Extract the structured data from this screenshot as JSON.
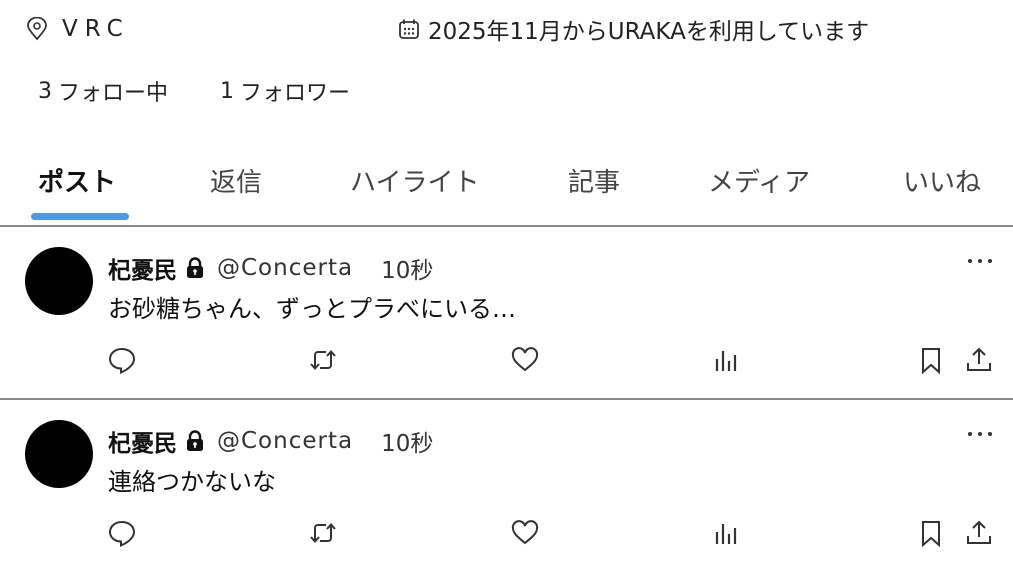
{
  "profile": {
    "location": "VRC",
    "joined": "2025年11月からURAKAを利用しています",
    "following_count": "3",
    "following_label": "フォロー中",
    "followers_count": "1",
    "followers_label": "フォロワー"
  },
  "tabs": [
    {
      "label": "ポスト",
      "active": true
    },
    {
      "label": "返信"
    },
    {
      "label": "ハイライト"
    },
    {
      "label": "記事"
    },
    {
      "label": "メディア"
    },
    {
      "label": "いいね"
    }
  ],
  "posts": [
    {
      "name": "杞憂民",
      "handle": "@Concerta",
      "time": "10秒",
      "text": "お砂糖ちゃん、ずっとプラべにいる…"
    },
    {
      "name": "杞憂民",
      "handle": "@Concerta",
      "time": "10秒",
      "text": "連絡つかないな"
    }
  ],
  "colors": {
    "accent": "#4a9ae8",
    "divider": "#8a8a8a",
    "avatar": "#000000"
  },
  "icons": [
    "location-pin-icon",
    "calendar-icon",
    "lock-icon",
    "more-icon",
    "reply-icon",
    "repost-icon",
    "like-icon",
    "views-icon",
    "bookmark-icon",
    "share-icon"
  ]
}
